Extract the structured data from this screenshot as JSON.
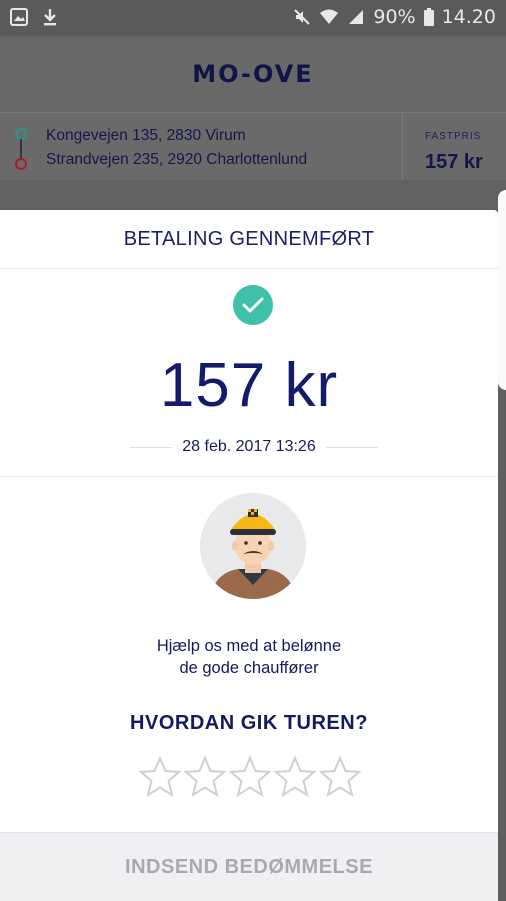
{
  "status_bar": {
    "battery": "90%",
    "time": "14.20"
  },
  "header": {
    "logo": "MO-OVE"
  },
  "route": {
    "from": "Kongevejen 135, 2830 Virum",
    "to": "Strandvejen 235, 2920 Charlottenlund",
    "fastpris_label": "FASTPRIS",
    "fastpris_value": "157 kr"
  },
  "payment": {
    "title": "BETALING GENNEMFØRT",
    "amount": "157 kr",
    "date": "28 feb. 2017 13:26"
  },
  "rating": {
    "help_line1": "Hjælp os med at belønne",
    "help_line2": "de gode chauffører",
    "question": "HVORDAN GIK TUREN?",
    "stars": 5,
    "submit_label": "INDSEND BEDØMMELSE"
  },
  "colors": {
    "accent_check": "#3fc0a8",
    "brand_navy": "#141b6a",
    "taxi_yellow": "#f6b712"
  }
}
